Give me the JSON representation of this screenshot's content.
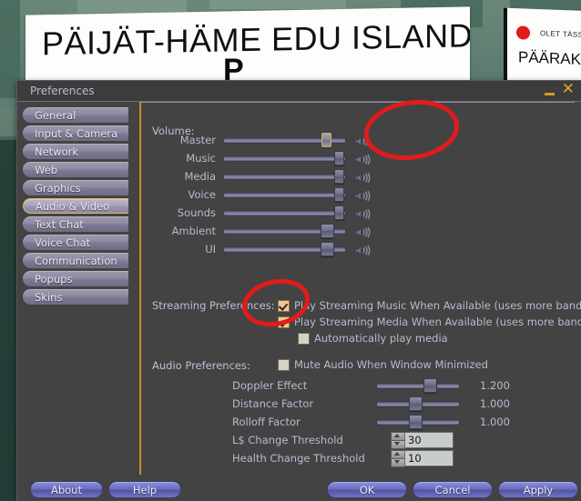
{
  "background": {
    "main_sign_text": "PÄIJÄT-HÄME EDU ISLAND",
    "main_sign_sub": "P",
    "right_sign_small": "OLET TÄSSÄ",
    "right_sign_big": "PÄÄRAKEN"
  },
  "window": {
    "title": "Preferences",
    "minimize_label": "–",
    "close_label": "✕"
  },
  "sidebar": {
    "items": [
      {
        "label": "General",
        "selected": false
      },
      {
        "label": "Input & Camera",
        "selected": false
      },
      {
        "label": "Network",
        "selected": false
      },
      {
        "label": "Web",
        "selected": false
      },
      {
        "label": "Graphics",
        "selected": false
      },
      {
        "label": "Audio & Video",
        "selected": true
      },
      {
        "label": "Text Chat",
        "selected": false
      },
      {
        "label": "Voice Chat",
        "selected": false
      },
      {
        "label": "Communication",
        "selected": false
      },
      {
        "label": "Popups",
        "selected": false
      },
      {
        "label": "Skins",
        "selected": false
      }
    ]
  },
  "content": {
    "volume_section_label": "Volume:",
    "volume_rows": [
      {
        "label": "Master",
        "value_pct": 86,
        "highlighted": true,
        "wide_thumb": false
      },
      {
        "label": "Music",
        "value_pct": 97,
        "highlighted": false,
        "wide_thumb": false
      },
      {
        "label": "Media",
        "value_pct": 97,
        "highlighted": false,
        "wide_thumb": false
      },
      {
        "label": "Voice",
        "value_pct": 97,
        "highlighted": false,
        "wide_thumb": false
      },
      {
        "label": "Sounds",
        "value_pct": 97,
        "highlighted": false,
        "wide_thumb": false
      },
      {
        "label": "Ambient",
        "value_pct": 88,
        "highlighted": false,
        "wide_thumb": true
      },
      {
        "label": "UI",
        "value_pct": 88,
        "highlighted": false,
        "wide_thumb": true
      }
    ],
    "streaming_section_label": "Streaming Preferences:",
    "streaming_checkboxes": [
      {
        "label": "Play Streaming Music When Available (uses more bandwidth)",
        "checked": true,
        "indent": 0
      },
      {
        "label": "Play Streaming Media When Available (uses more bandwidth)",
        "checked": true,
        "indent": 0
      },
      {
        "label": "Automatically play media",
        "checked": false,
        "indent": 22
      }
    ],
    "audio_section_label": "Audio Preferences:",
    "audio_checkbox": {
      "label": "Mute Audio When Window Minimized",
      "checked": false
    },
    "audio_sliders": [
      {
        "label": "Doppler Effect",
        "value": "1.200",
        "value_pct": 66
      },
      {
        "label": "Distance Factor",
        "value": "1.000",
        "value_pct": 46
      },
      {
        "label": "Rolloff Factor",
        "value": "1.000",
        "value_pct": 46
      }
    ],
    "spinners": [
      {
        "label": "L$ Change Threshold",
        "value": "30"
      },
      {
        "label": "Health Change Threshold",
        "value": "10"
      }
    ]
  },
  "footer": {
    "left_buttons": [
      {
        "label": "About"
      },
      {
        "label": "Help"
      }
    ],
    "right_buttons": [
      {
        "label": "OK"
      },
      {
        "label": "Cancel"
      },
      {
        "label": "Apply"
      }
    ]
  },
  "annotations": {
    "accent_color": "#e01b1b",
    "marks": [
      {
        "name": "master-volume-circle"
      },
      {
        "name": "streaming-checkboxes-circle"
      }
    ]
  },
  "theme": {
    "window_bg": "#434343",
    "tab_accent": "#e2bc52",
    "divider": "#cd8a2b",
    "text": "#b7bbcf",
    "button": "#6a6dc0"
  }
}
